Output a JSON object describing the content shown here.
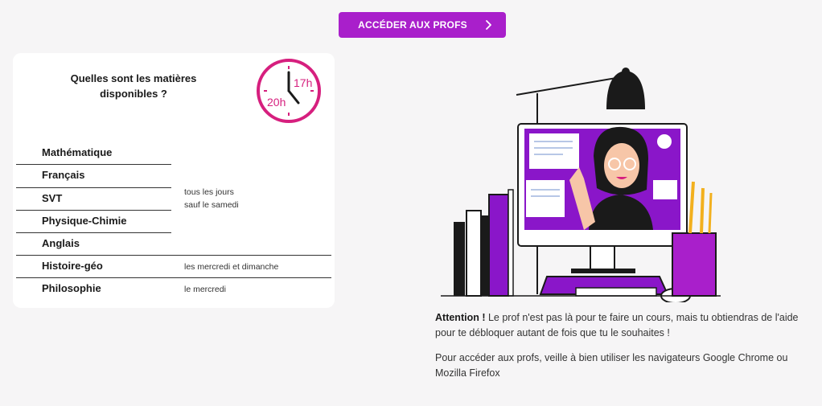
{
  "cta": {
    "label": "ACCÉDER AUX PROFS",
    "icon": "chevron-right-icon",
    "color": "#a91fcb"
  },
  "card": {
    "title": "Quelles sont les matières disponibles ?",
    "clock": {
      "icon": "clock-icon",
      "time_a": "17h",
      "time_b": "20h",
      "color": "#d61f7e"
    },
    "subjects": [
      {
        "name": "Mathématique"
      },
      {
        "name": "Français"
      },
      {
        "name": "SVT"
      },
      {
        "name": "Physique-Chimie"
      },
      {
        "name": "Anglais"
      },
      {
        "name": "Histoire-géo"
      },
      {
        "name": "Philosophie"
      }
    ],
    "schedules": {
      "group1_line1": "tous les jours",
      "group1_line2": "sauf le samedi",
      "histoire": "les mercredi et dimanche",
      "philo": "le mercredi"
    }
  },
  "info": {
    "attention_label": "Attention !",
    "attention_text": " Le prof n'est pas là pour te faire un cours, mais tu obtiendras de l'aide pour te débloquer autant de fois que tu le souhaites !",
    "browsers_text": "Pour accéder aux profs, veille à bien utiliser les navigateurs Google Chrome ou Mozilla Firefox"
  }
}
